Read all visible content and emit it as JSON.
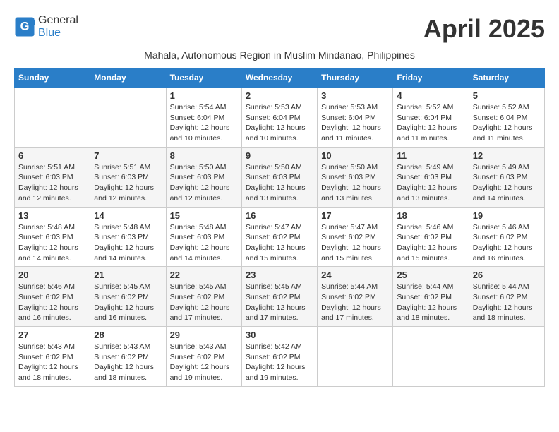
{
  "header": {
    "logo_general": "General",
    "logo_blue": "Blue",
    "month_title": "April 2025",
    "subtitle": "Mahala, Autonomous Region in Muslim Mindanao, Philippines"
  },
  "weekdays": [
    "Sunday",
    "Monday",
    "Tuesday",
    "Wednesday",
    "Thursday",
    "Friday",
    "Saturday"
  ],
  "weeks": [
    [
      {
        "day": "",
        "info": ""
      },
      {
        "day": "",
        "info": ""
      },
      {
        "day": "1",
        "info": "Sunrise: 5:54 AM\nSunset: 6:04 PM\nDaylight: 12 hours and 10 minutes."
      },
      {
        "day": "2",
        "info": "Sunrise: 5:53 AM\nSunset: 6:04 PM\nDaylight: 12 hours and 10 minutes."
      },
      {
        "day": "3",
        "info": "Sunrise: 5:53 AM\nSunset: 6:04 PM\nDaylight: 12 hours and 11 minutes."
      },
      {
        "day": "4",
        "info": "Sunrise: 5:52 AM\nSunset: 6:04 PM\nDaylight: 12 hours and 11 minutes."
      },
      {
        "day": "5",
        "info": "Sunrise: 5:52 AM\nSunset: 6:04 PM\nDaylight: 12 hours and 11 minutes."
      }
    ],
    [
      {
        "day": "6",
        "info": "Sunrise: 5:51 AM\nSunset: 6:03 PM\nDaylight: 12 hours and 12 minutes."
      },
      {
        "day": "7",
        "info": "Sunrise: 5:51 AM\nSunset: 6:03 PM\nDaylight: 12 hours and 12 minutes."
      },
      {
        "day": "8",
        "info": "Sunrise: 5:50 AM\nSunset: 6:03 PM\nDaylight: 12 hours and 12 minutes."
      },
      {
        "day": "9",
        "info": "Sunrise: 5:50 AM\nSunset: 6:03 PM\nDaylight: 12 hours and 13 minutes."
      },
      {
        "day": "10",
        "info": "Sunrise: 5:50 AM\nSunset: 6:03 PM\nDaylight: 12 hours and 13 minutes."
      },
      {
        "day": "11",
        "info": "Sunrise: 5:49 AM\nSunset: 6:03 PM\nDaylight: 12 hours and 13 minutes."
      },
      {
        "day": "12",
        "info": "Sunrise: 5:49 AM\nSunset: 6:03 PM\nDaylight: 12 hours and 14 minutes."
      }
    ],
    [
      {
        "day": "13",
        "info": "Sunrise: 5:48 AM\nSunset: 6:03 PM\nDaylight: 12 hours and 14 minutes."
      },
      {
        "day": "14",
        "info": "Sunrise: 5:48 AM\nSunset: 6:03 PM\nDaylight: 12 hours and 14 minutes."
      },
      {
        "day": "15",
        "info": "Sunrise: 5:48 AM\nSunset: 6:03 PM\nDaylight: 12 hours and 14 minutes."
      },
      {
        "day": "16",
        "info": "Sunrise: 5:47 AM\nSunset: 6:02 PM\nDaylight: 12 hours and 15 minutes."
      },
      {
        "day": "17",
        "info": "Sunrise: 5:47 AM\nSunset: 6:02 PM\nDaylight: 12 hours and 15 minutes."
      },
      {
        "day": "18",
        "info": "Sunrise: 5:46 AM\nSunset: 6:02 PM\nDaylight: 12 hours and 15 minutes."
      },
      {
        "day": "19",
        "info": "Sunrise: 5:46 AM\nSunset: 6:02 PM\nDaylight: 12 hours and 16 minutes."
      }
    ],
    [
      {
        "day": "20",
        "info": "Sunrise: 5:46 AM\nSunset: 6:02 PM\nDaylight: 12 hours and 16 minutes."
      },
      {
        "day": "21",
        "info": "Sunrise: 5:45 AM\nSunset: 6:02 PM\nDaylight: 12 hours and 16 minutes."
      },
      {
        "day": "22",
        "info": "Sunrise: 5:45 AM\nSunset: 6:02 PM\nDaylight: 12 hours and 17 minutes."
      },
      {
        "day": "23",
        "info": "Sunrise: 5:45 AM\nSunset: 6:02 PM\nDaylight: 12 hours and 17 minutes."
      },
      {
        "day": "24",
        "info": "Sunrise: 5:44 AM\nSunset: 6:02 PM\nDaylight: 12 hours and 17 minutes."
      },
      {
        "day": "25",
        "info": "Sunrise: 5:44 AM\nSunset: 6:02 PM\nDaylight: 12 hours and 18 minutes."
      },
      {
        "day": "26",
        "info": "Sunrise: 5:44 AM\nSunset: 6:02 PM\nDaylight: 12 hours and 18 minutes."
      }
    ],
    [
      {
        "day": "27",
        "info": "Sunrise: 5:43 AM\nSunset: 6:02 PM\nDaylight: 12 hours and 18 minutes."
      },
      {
        "day": "28",
        "info": "Sunrise: 5:43 AM\nSunset: 6:02 PM\nDaylight: 12 hours and 18 minutes."
      },
      {
        "day": "29",
        "info": "Sunrise: 5:43 AM\nSunset: 6:02 PM\nDaylight: 12 hours and 19 minutes."
      },
      {
        "day": "30",
        "info": "Sunrise: 5:42 AM\nSunset: 6:02 PM\nDaylight: 12 hours and 19 minutes."
      },
      {
        "day": "",
        "info": ""
      },
      {
        "day": "",
        "info": ""
      },
      {
        "day": "",
        "info": ""
      }
    ]
  ]
}
